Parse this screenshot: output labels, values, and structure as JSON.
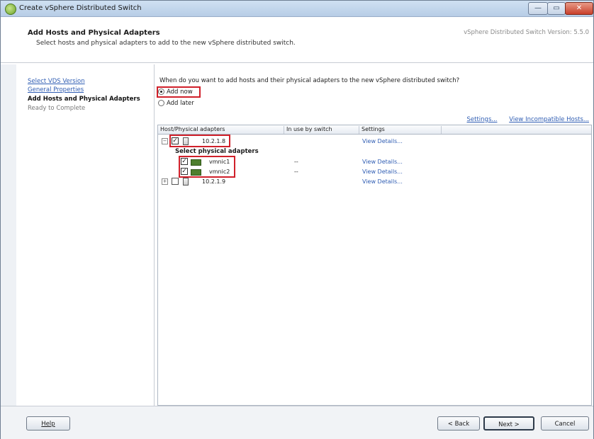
{
  "window": {
    "title": "Create vSphere Distributed Switch",
    "controls": {
      "minimize": "—",
      "maximize": "▭",
      "close": "✕"
    }
  },
  "header": {
    "title": "Add Hosts and Physical Adapters",
    "subtitle": "Select hosts and physical adapters to add to the new vSphere distributed switch.",
    "version": "vSphere Distributed Switch Version: 5.5.0"
  },
  "sidebar": {
    "steps": [
      {
        "label": "Select VDS Version",
        "state": "link"
      },
      {
        "label": "General Properties",
        "state": "link"
      },
      {
        "label": "Add Hosts and Physical Adapters",
        "state": "current"
      },
      {
        "label": "Ready to Complete",
        "state": "future"
      }
    ]
  },
  "content": {
    "question": "When do you want to add hosts and their physical adapters to the new vSphere distributed switch?",
    "options": [
      {
        "label": "Add now",
        "selected": true
      },
      {
        "label": "Add later",
        "selected": false
      }
    ],
    "links": {
      "settings": "Settings...",
      "incompatible": "View Incompatible Hosts..."
    }
  },
  "table": {
    "headers": [
      "Host/Physical adapters",
      "In use by switch",
      "Settings"
    ],
    "rows": [
      {
        "kind": "host",
        "expanded": true,
        "checked": true,
        "name": "10.2.1.8",
        "in_use": "",
        "settings": "View Details..."
      },
      {
        "kind": "group",
        "name": "Select physical adapters"
      },
      {
        "kind": "nic",
        "checked": true,
        "name": "vmnic1",
        "in_use": "--",
        "settings": "View Details..."
      },
      {
        "kind": "nic",
        "checked": true,
        "name": "vmnic2",
        "in_use": "--",
        "settings": "View Details..."
      },
      {
        "kind": "host",
        "expanded": false,
        "checked": false,
        "name": "10.2.1.9",
        "in_use": "",
        "settings": "View Details..."
      }
    ],
    "expander_symbols": {
      "collapse": "−",
      "expand": "+"
    },
    "check_mark": "✓"
  },
  "footer": {
    "help": "Help",
    "back": "< Back",
    "next": "Next >",
    "cancel": "Cancel"
  },
  "colors": {
    "highlight": "#d0202a",
    "link": "#2f5db3"
  }
}
